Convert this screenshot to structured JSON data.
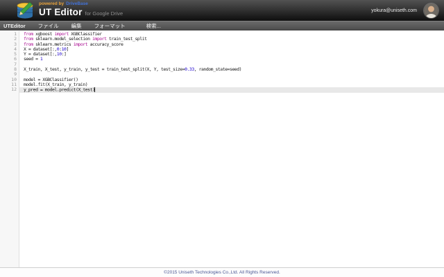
{
  "header": {
    "powered_by_label": "powered by",
    "brand_label": "DriveBase",
    "title": "UT Editor",
    "subtitle": "for Google Drive",
    "user_email": "yokura@uniseth.com",
    "logo_icon": "database-pencil-icon",
    "avatar_icon": "user-avatar"
  },
  "menu": {
    "items": [
      {
        "label": "UTEditor"
      },
      {
        "label": "ファイル"
      },
      {
        "label": "編集"
      },
      {
        "label": "フォーマット"
      },
      {
        "label": "検索..."
      }
    ]
  },
  "editor": {
    "active_line": 12,
    "cursor_line": 12,
    "lines": [
      {
        "num": "1",
        "tokens": [
          {
            "text": "from ",
            "type": "keyword"
          },
          {
            "text": "xgboost ",
            "type": "plain"
          },
          {
            "text": "import ",
            "type": "keyword"
          },
          {
            "text": "XGBClassifier",
            "type": "plain"
          }
        ]
      },
      {
        "num": "2",
        "tokens": [
          {
            "text": "from ",
            "type": "keyword"
          },
          {
            "text": "sklearn.model_selection ",
            "type": "plain"
          },
          {
            "text": "import ",
            "type": "keyword"
          },
          {
            "text": "train_test_split",
            "type": "plain"
          }
        ]
      },
      {
        "num": "3",
        "tokens": [
          {
            "text": "from ",
            "type": "keyword"
          },
          {
            "text": "sklearn.metrics ",
            "type": "plain"
          },
          {
            "text": "import ",
            "type": "keyword"
          },
          {
            "text": "accuracy_score",
            "type": "plain"
          }
        ]
      },
      {
        "num": "4",
        "tokens": [
          {
            "text": "X = dataset[:,",
            "type": "plain"
          },
          {
            "text": "0",
            "type": "number"
          },
          {
            "text": ":",
            "type": "plain"
          },
          {
            "text": "10",
            "type": "number"
          },
          {
            "text": "]",
            "type": "plain"
          }
        ]
      },
      {
        "num": "5",
        "tokens": [
          {
            "text": "Y = dataset[:,",
            "type": "plain"
          },
          {
            "text": "10",
            "type": "number"
          },
          {
            "text": ":]",
            "type": "plain"
          }
        ]
      },
      {
        "num": "6",
        "tokens": [
          {
            "text": "seed = ",
            "type": "plain"
          },
          {
            "text": "1",
            "type": "number"
          }
        ]
      },
      {
        "num": "7",
        "tokens": []
      },
      {
        "num": "8",
        "tokens": [
          {
            "text": "X_train, X_test, y_train, y_test = train_test_split(X, Y, test_size=",
            "type": "plain"
          },
          {
            "text": "0.33",
            "type": "number"
          },
          {
            "text": ", random_state=seed)",
            "type": "plain"
          }
        ]
      },
      {
        "num": "9",
        "tokens": []
      },
      {
        "num": "10",
        "tokens": [
          {
            "text": "model = XGBClassifier()",
            "type": "plain"
          }
        ]
      },
      {
        "num": "11",
        "tokens": [
          {
            "text": "model.fit(X_train, y_train)",
            "type": "plain"
          }
        ]
      },
      {
        "num": "12",
        "tokens": [
          {
            "text": "y_pred = model.predict(X_test)",
            "type": "plain"
          }
        ]
      }
    ],
    "colors": {
      "keyword": "#aa0d91",
      "number": "#1c00cf",
      "plain": "#1a1a1a",
      "line_number": "#999999",
      "active_line_bg": "#e8e8e8"
    }
  },
  "footer": {
    "copyright": "©2015 Uniseth Technologies Co.,Ltd. All Rights Reserved."
  },
  "colors": {
    "powered_by": "#e8a33d",
    "brand": "#4272d8",
    "footer_text": "#4a5795"
  }
}
